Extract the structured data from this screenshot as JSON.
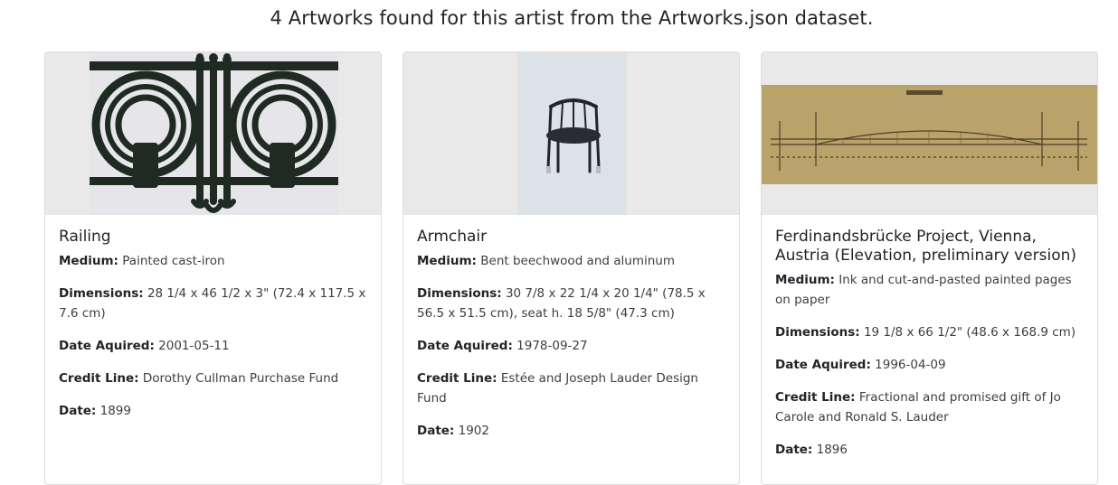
{
  "page": {
    "heading": "4 Artworks found for this artist from the Artworks.json dataset."
  },
  "labels": {
    "medium": "Medium:",
    "dimensions": "Dimensions:",
    "date_acquired": "Date Aquired:",
    "credit_line": "Credit Line:",
    "date": "Date:"
  },
  "artworks": [
    {
      "title": "Railing",
      "medium": "Painted cast-iron",
      "dimensions": "28 1/4 x 46 1/2 x 3\" (72.4 x 117.5 x 7.6 cm)",
      "date_acquired": "2001-05-11",
      "credit_line": "Dorothy Cullman Purchase Fund",
      "date": "1899",
      "image_icon": "railing-photo"
    },
    {
      "title": "Armchair",
      "medium": "Bent beechwood and aluminum",
      "dimensions": "30 7/8 x 22 1/4 x 20 1/4\" (78.5 x 56.5 x 51.5 cm), seat h. 18 5/8\" (47.3 cm)",
      "date_acquired": "1978-09-27",
      "credit_line": "Estée and Joseph Lauder Design Fund",
      "date": "1902",
      "image_icon": "armchair-photo"
    },
    {
      "title": "Ferdinandsbrücke Project, Vienna, Austria (Elevation, preliminary version)",
      "medium": "Ink and cut-and-pasted painted pages on paper",
      "dimensions": "19 1/8 x 66 1/2\" (48.6 x 168.9 cm)",
      "date_acquired": "1996-04-09",
      "credit_line": "Fractional and promised gift of Jo Carole and Ronald S. Lauder",
      "date": "1896",
      "image_icon": "bridge-drawing"
    }
  ]
}
